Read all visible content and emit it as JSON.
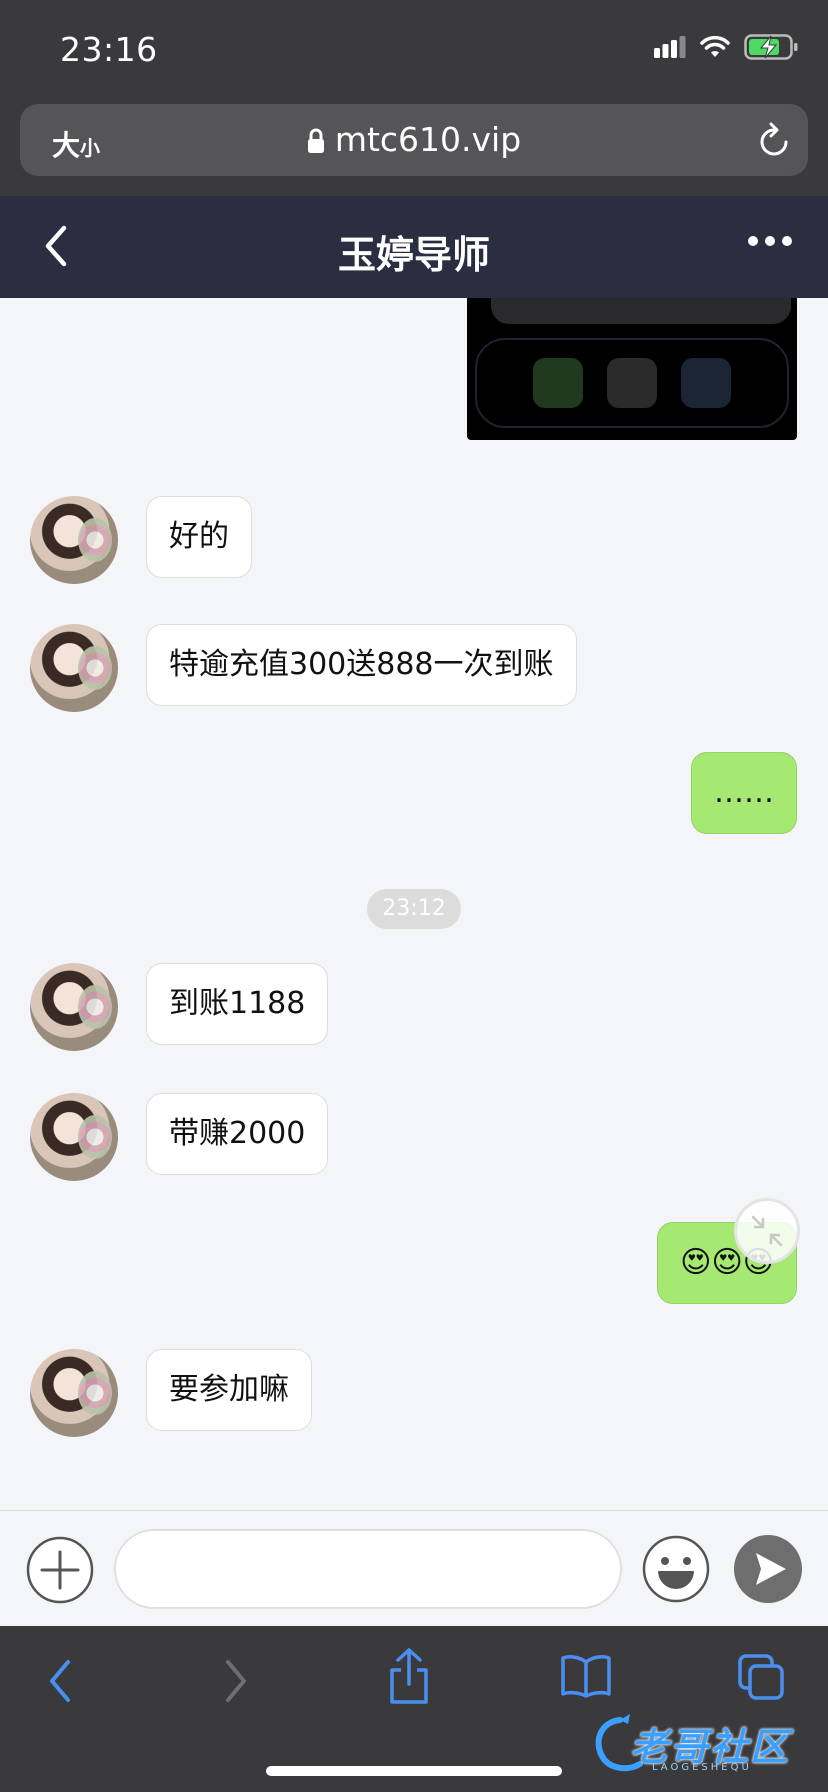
{
  "status_bar": {
    "time": "23:16"
  },
  "browser": {
    "text_size_label": "大",
    "text_size_small": "小",
    "url": "mtc610.vip"
  },
  "header": {
    "title": "玉婷导师"
  },
  "messages": [
    {
      "dir": "in",
      "text": "好的"
    },
    {
      "dir": "in",
      "text": "特逾充值300送888一次到账"
    },
    {
      "dir": "out",
      "text": "……"
    },
    {
      "dir": "time",
      "text": "23:12"
    },
    {
      "dir": "in",
      "text": "到账1188"
    },
    {
      "dir": "in",
      "text": "带赚2000"
    },
    {
      "dir": "out",
      "text": "😍😍😍"
    },
    {
      "dir": "in",
      "text": "要参加嘛"
    }
  ],
  "input": {
    "value": "",
    "placeholder": ""
  },
  "watermark": {
    "text": "老哥社区",
    "sub": "LAOGESHEQU"
  },
  "colors": {
    "header_bg": "#2b2d40",
    "out_bubble": "#a5e872",
    "chat_bg": "#f4f5f9",
    "browser_chrome": "#3a3a3c",
    "toolbar_icon": "#4a8ff0"
  }
}
